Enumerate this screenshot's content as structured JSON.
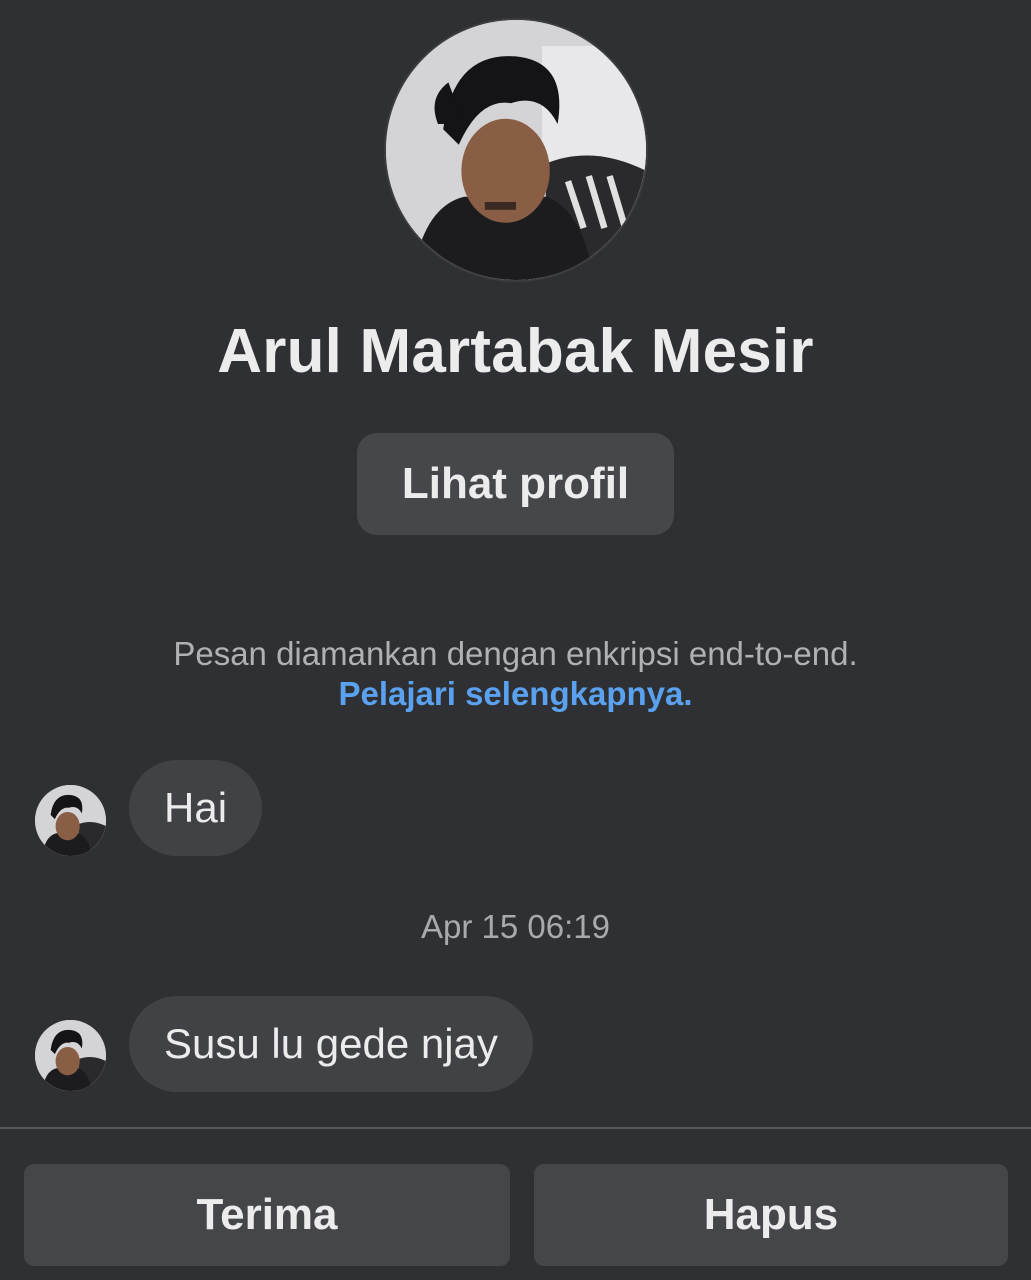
{
  "profile": {
    "name": "Arul Martabak Mesir",
    "avatar_icon": "profile-photo",
    "view_profile_label": "Lihat profil"
  },
  "encryption": {
    "note": "Pesan diamankan dengan enkripsi end-to-end.",
    "learn_more": "Pelajari selengkapnya."
  },
  "messages": [
    {
      "text": "Hai"
    },
    {
      "text": "Susu lu gede njay"
    }
  ],
  "timestamp": "Apr 15 06:19",
  "actions": {
    "accept_label": "Terima",
    "delete_label": "Hapus"
  },
  "colors": {
    "background": "#2f3033",
    "bubble": "#414246",
    "button": "#46474b",
    "link": "#5aa2f0"
  }
}
